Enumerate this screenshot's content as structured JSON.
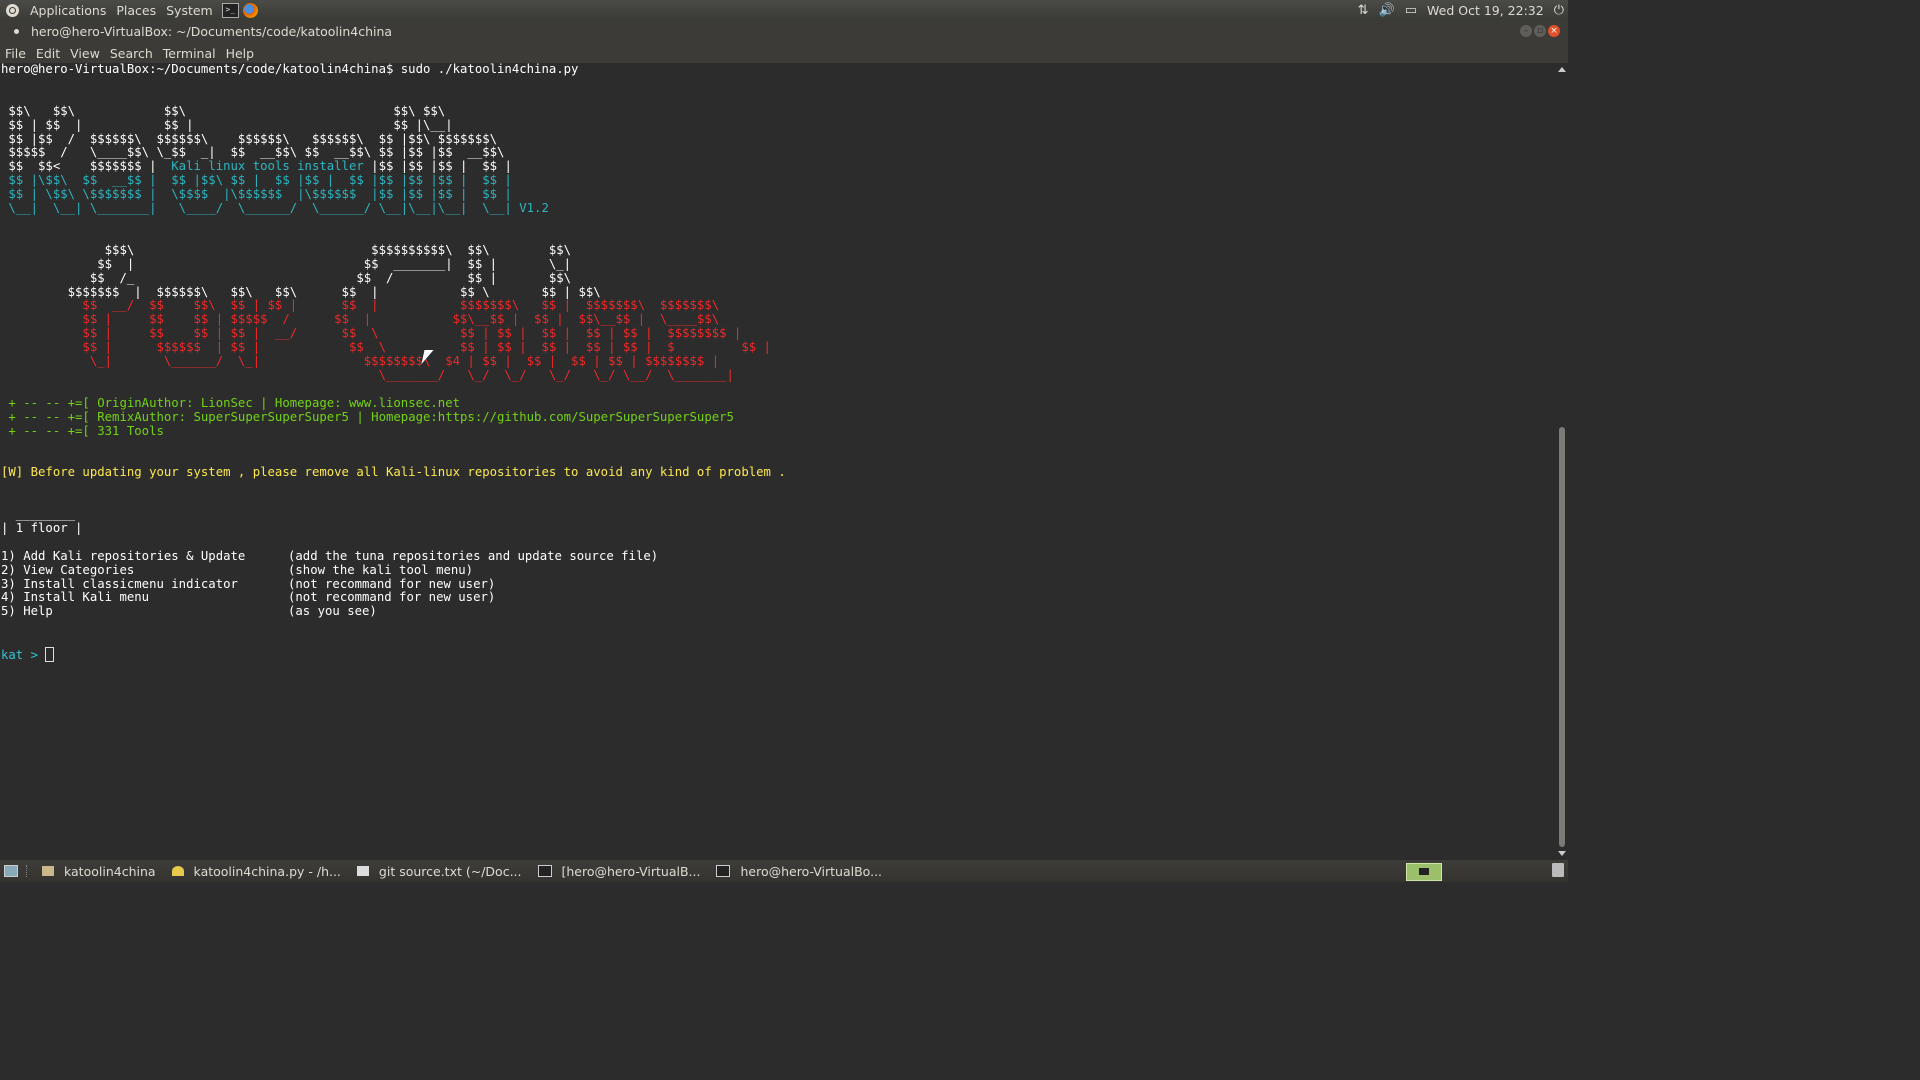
{
  "top_panel": {
    "menus": [
      "Applications",
      "Places",
      "System"
    ],
    "launchers": [
      "terminal-launcher-icon",
      "firefox-launcher-icon"
    ],
    "clock": "Wed Oct 19, 22:32"
  },
  "window": {
    "title": "hero@hero-VirtualBox: ~/Documents/code/katoolin4china"
  },
  "menubar": [
    "File",
    "Edit",
    "View",
    "Search",
    "Terminal",
    "Help"
  ],
  "terminal": {
    "prompt_line": "hero@hero-VirtualBox:~/Documents/code/katoolin4china$ sudo ./katoolin4china.py",
    "banner_white": " $$\\   $$\\            $$\\                            $$\\ $$\\\n $$ | $$  |           $$ |                           $$ |\\__|\n $$ |$$  /  $$$$$$\\  $$$$$$\\    $$$$$$\\   $$$$$$\\  $$ |$$\\ $$$$$$$\\\n $$$$$  /   \\____$$\\ \\_$$  _|  $$  __$$\\ $$  __$$\\ $$ |$$ |$$  __$$\\",
    "banner_line5_pre": " $$  $$<    $$$$$$$ |  ",
    "banner_line5_text": "Kali linux tools installer",
    "banner_line5_post": " |$$ |$$ |$$ |  $$ |",
    "banner_cyan": " $$ |\\$$\\  $$  __$$ |  $$ |$$\\ $$ |  $$ |$$ |  $$ |$$ |$$ |$$ |  $$ |\n $$ | \\$$\\ \\$$$$$$$ |  \\$$$$  |\\$$$$$$  |\\$$$$$$  |$$ |$$ |$$ |  $$ |",
    "banner_last_line": " \\__|  \\__| \\_______|   \\____/  \\______/  \\______/ \\__|\\__|\\__|  \\__|",
    "version": " V1.2",
    "china_white": "              $$$\\                                $$$$$$$$$$\\  $$\\        $$\\\n             $$  |                               $$  _______|  $$ |       \\_|\n            $$  /_                              $$  /          $$ |       $$\\\n         $$$$$$$  |  $$$$$$\\   $$\\   $$\\      $$  |           $$ \\       $$ | $$\\",
    "china_red": "           $$  __/  $$    $$\\  $$ | $$ |      $$  |           $$$$$$$\\   $$ |  $$$$$$$\\  $$$$$$$\\\n           $$ |     $$    $$ | $$$$$  /      $$  |           $$\\__$$ |  $$ |  $$\\__$$ |  \\____$$\\\n           $$ |     $$    $$ | $$ |  __/      $$  \\           $$ | $$ |  $$ |  $$ | $$ |  $$$$$$$$ |\n           $$ |      $$$$$$  | $$ |            $$  \\          $$ | $$ |  $$ |  $$ | $$ |  $         $$ |\n            \\_|       \\______/  \\_|              $$$$$$$$\\  $4 | $$ |  $$ |  $$ | $$ | $$$$$$$$ |\n                                                   \\_______/   \\_/  \\_/   \\_/   \\_/ \\__/  \\_______|",
    "info_prefix": " + -- -- +=[ ",
    "info_lines": [
      "OriginAuthor: LionSec | Homepage: www.lionsec.net",
      "RemixAuthor: SuperSuperSuperSuper5 | Homepage:https://github.com/SuperSuperSuperSuper5",
      "331 Tools"
    ],
    "warning": "[W] Before updating your system , please remove all Kali-linux repositories to avoid any kind of problem .",
    "floor_top": "  ________",
    "floor_label": "| 1 floor |",
    "menu_items": [
      {
        "label": "1) Add Kali repositories & Update",
        "desc": "(add the tuna repositories and update source file)"
      },
      {
        "label": "2) View Categories",
        "desc": "(show the kali tool menu)"
      },
      {
        "label": "3) Install classicmenu indicator",
        "desc": "(not recommand for new user)"
      },
      {
        "label": "4) Install Kali menu",
        "desc": "(not recommand for new user)"
      },
      {
        "label": "5) Help",
        "desc": "(as you see)"
      }
    ],
    "input_prompt": "kat > "
  },
  "taskbar": {
    "tasks": [
      {
        "icon": "folder-icon",
        "label": "katoolin4china"
      },
      {
        "icon": "gedit-icon",
        "label": "katoolin4china.py - /h..."
      },
      {
        "icon": "text-editor-icon",
        "label": "git source.txt (~/Doc..."
      },
      {
        "icon": "terminal-icon",
        "label": "[hero@hero-VirtualB..."
      },
      {
        "icon": "terminal-icon",
        "label": "hero@hero-VirtualBo..."
      }
    ]
  },
  "colors": {
    "terminal_bg": "#2c2c2c",
    "cyan": "#34e2e2",
    "red": "#ef2929",
    "green": "#8ae234",
    "yellow": "#fce94f"
  }
}
